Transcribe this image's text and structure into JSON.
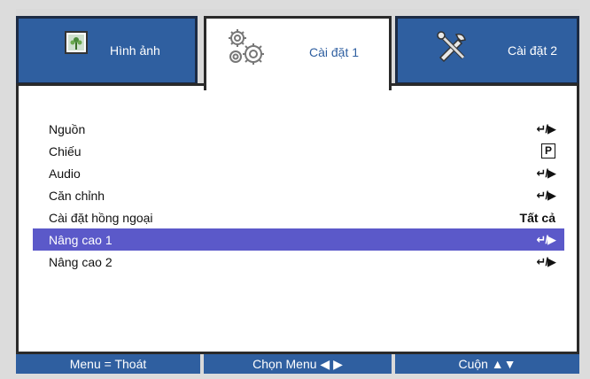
{
  "tabs": [
    {
      "label": "Hình ảnh",
      "icon": "picture-icon"
    },
    {
      "label": "Cài đặt 1",
      "icon": "gears-icon"
    },
    {
      "label": "Cài đặt 2",
      "icon": "tools-icon"
    }
  ],
  "menu": {
    "items": [
      {
        "label": "Nguồn",
        "value_type": "enter",
        "value": "↵/▶"
      },
      {
        "label": "Chiếu",
        "value_type": "badge",
        "value": "P"
      },
      {
        "label": "Audio",
        "value_type": "enter",
        "value": "↵/▶"
      },
      {
        "label": "Căn chỉnh",
        "value_type": "enter",
        "value": "↵/▶"
      },
      {
        "label": "Cài đặt hồng ngoại",
        "value_type": "text",
        "value": "Tất cả"
      },
      {
        "label": "Nâng cao 1",
        "value_type": "enter",
        "value": "↵/▶"
      },
      {
        "label": "Nâng cao 2",
        "value_type": "enter",
        "value": "↵/▶"
      }
    ],
    "selected_index": 5
  },
  "footer": {
    "exit": "Menu = Thoát",
    "select": "Chọn Menu ◀ ▶",
    "scroll": "Cuộn ▲▼"
  },
  "colors": {
    "tab_blue": "#2f5fa0",
    "selection": "#5b59c9",
    "panel_bg": "#ffffff"
  }
}
